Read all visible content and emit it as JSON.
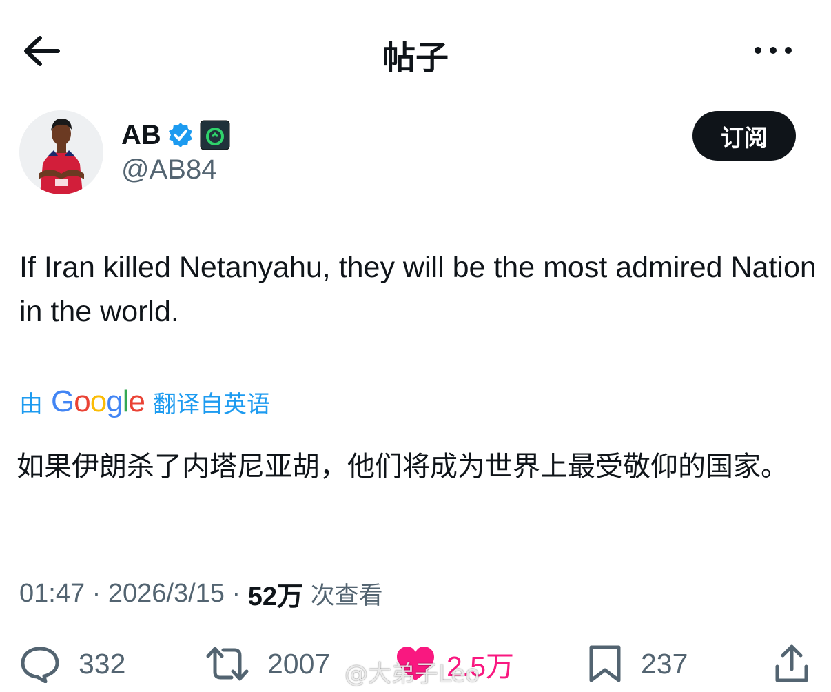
{
  "header": {
    "title": "帖子"
  },
  "author": {
    "display_name": "AB",
    "handle": "@AB84",
    "verified": true,
    "subscribe_label": "订阅"
  },
  "tweet": {
    "text": "If Iran killed Netanyahu, they will be the most admired Nation in the world.",
    "translate_prefix": "由",
    "translate_provider": "Google",
    "translate_suffix": "翻译自英语",
    "translated_text": "如果伊朗杀了内塔尼亚胡，他们将成为世界上最受敬仰的国家。",
    "time": "01:47",
    "date": "2026/3/15",
    "views_count": "52万",
    "views_label": "次查看"
  },
  "actions": {
    "replies": "332",
    "reposts": "2007",
    "likes": "2.5万",
    "bookmarks": "237"
  },
  "watermark": "@大弟子Leo",
  "colors": {
    "accent": "#1d9bf0",
    "like": "#f91880",
    "secondary_text": "#536471",
    "primary_text": "#0f1419"
  }
}
